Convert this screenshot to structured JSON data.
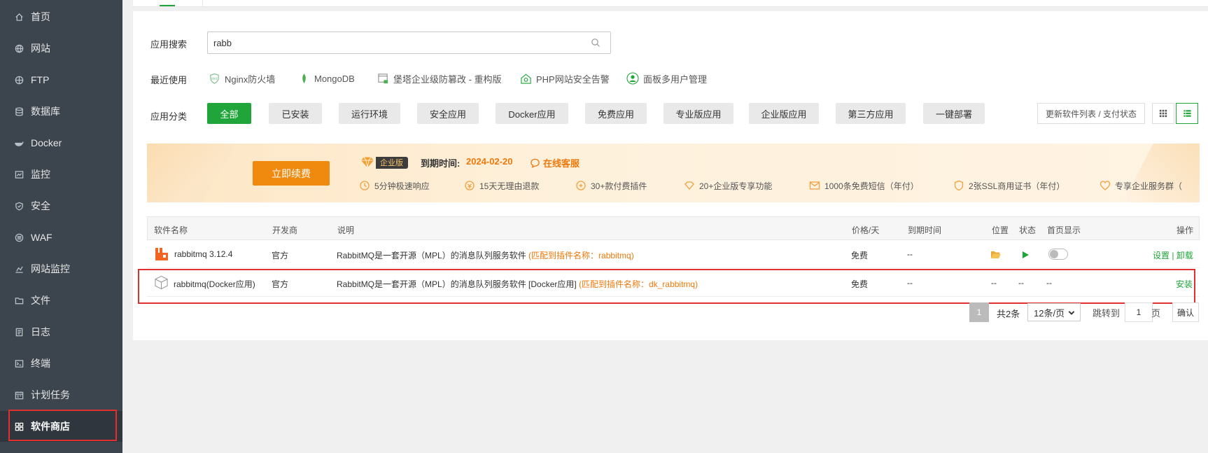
{
  "sidebar": {
    "items": [
      {
        "label": "首页",
        "icon": "home-icon"
      },
      {
        "label": "网站",
        "icon": "globe-icon"
      },
      {
        "label": "FTP",
        "icon": "ftp-icon"
      },
      {
        "label": "数据库",
        "icon": "database-icon"
      },
      {
        "label": "Docker",
        "icon": "docker-icon"
      },
      {
        "label": "监控",
        "icon": "monitor-icon"
      },
      {
        "label": "安全",
        "icon": "shield-icon"
      },
      {
        "label": "WAF",
        "icon": "waf-icon"
      },
      {
        "label": "网站监控",
        "icon": "chart-icon"
      },
      {
        "label": "文件",
        "icon": "folder-icon"
      },
      {
        "label": "日志",
        "icon": "log-icon"
      },
      {
        "label": "终端",
        "icon": "terminal-icon"
      },
      {
        "label": "计划任务",
        "icon": "calendar-icon"
      },
      {
        "label": "软件商店",
        "icon": "apps-icon"
      }
    ],
    "active_index": 13
  },
  "search": {
    "label": "应用搜索",
    "value": "rabb"
  },
  "recent": {
    "label": "最近使用",
    "items": [
      "Nginx防火墙",
      "MongoDB",
      "堡塔企业级防篡改 - 重构版",
      "PHP网站安全告警",
      "面板多用户管理"
    ]
  },
  "categories": {
    "label": "应用分类",
    "items": [
      "全部",
      "已安装",
      "运行环境",
      "安全应用",
      "Docker应用",
      "免费应用",
      "专业版应用",
      "企业版应用",
      "第三方应用",
      "一键部署"
    ],
    "active_index": 0,
    "update_label": "更新软件列表 / 支付状态"
  },
  "banner": {
    "renew_label": "立即续费",
    "edition_label": "企业版",
    "expire_label": "到期时间:",
    "expire_date": "2024-02-20",
    "service_label": "在线客服",
    "features": [
      "5分钟极速响应",
      "15天无理由退款",
      "30+款付费插件",
      "20+企业版专享功能",
      "1000条免费短信（年付）",
      "2张SSL商用证书（年付）",
      "专享企业服务群（"
    ]
  },
  "table": {
    "headers": [
      "软件名称",
      "开发商",
      "说明",
      "价格/天",
      "到期时间",
      "位置",
      "状态",
      "首页显示",
      "操作"
    ],
    "rows": [
      {
        "name": "rabbitmq 3.12.4",
        "developer": "官方",
        "desc": "RabbitMQ是一套开源（MPL）的消息队列服务软件",
        "match": "(匹配到插件名称：rabbitmq)",
        "price": "免费",
        "expire": "--",
        "action_settings": "设置",
        "action_sep": "|",
        "action_uninstall": "卸载"
      },
      {
        "name": "rabbitmq(Docker应用)",
        "developer": "官方",
        "desc": "RabbitMQ是一套开源（MPL）的消息队列服务软件 [Docker应用]",
        "match": "(匹配到插件名称：dk_rabbitmq)",
        "price": "免费",
        "expire": "--",
        "location": "--",
        "status": "--",
        "homepage": "--",
        "action_install": "安装"
      }
    ]
  },
  "pagination": {
    "current": "1",
    "total": "共2条",
    "page_size": "12条/页",
    "jump_label": "跳转到",
    "jump_value": "1",
    "page_unit": "页",
    "confirm_label": "确认"
  },
  "colors": {
    "sidebar_bg": "#3c444d",
    "accent_green": "#20a53a",
    "accent_orange": "#f0780a",
    "highlight_red": "#e02f2f"
  }
}
